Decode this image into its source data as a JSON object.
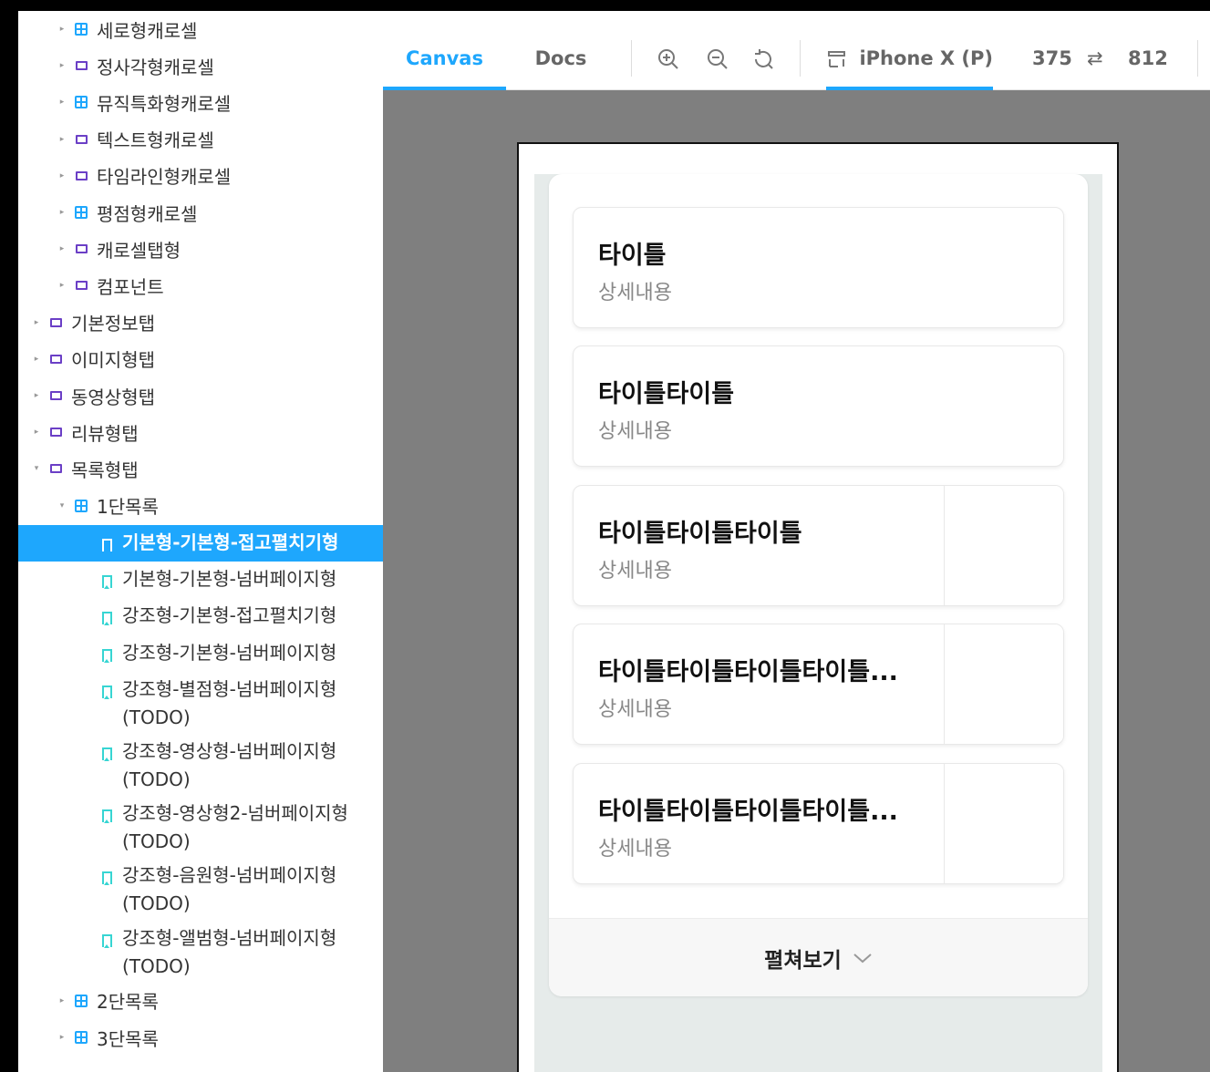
{
  "sidebar": {
    "items": [
      {
        "label": "세로형캐로셀",
        "icon": "component-icon",
        "level": 2,
        "expanded": false
      },
      {
        "label": "정사각형캐로셀",
        "icon": "folder-icon",
        "level": 2,
        "expanded": false
      },
      {
        "label": "뮤직특화형캐로셀",
        "icon": "component-icon",
        "level": 2,
        "expanded": false
      },
      {
        "label": "텍스트형캐로셀",
        "icon": "folder-icon",
        "level": 2,
        "expanded": false
      },
      {
        "label": "타임라인형캐로셀",
        "icon": "folder-icon",
        "level": 2,
        "expanded": false
      },
      {
        "label": "평점형캐로셀",
        "icon": "component-icon",
        "level": 2,
        "expanded": false
      },
      {
        "label": "캐로셀탭형",
        "icon": "folder-icon",
        "level": 2,
        "expanded": false
      },
      {
        "label": "컴포넌트",
        "icon": "folder-icon",
        "level": 2,
        "expanded": false
      },
      {
        "label": "기본정보탭",
        "icon": "folder-icon",
        "level": 1,
        "expanded": false
      },
      {
        "label": "이미지형탭",
        "icon": "folder-icon",
        "level": 1,
        "expanded": false
      },
      {
        "label": "동영상형탭",
        "icon": "folder-icon",
        "level": 1,
        "expanded": false
      },
      {
        "label": "리뷰형탭",
        "icon": "folder-icon",
        "level": 1,
        "expanded": false
      },
      {
        "label": "목록형탭",
        "icon": "folder-icon",
        "level": 1,
        "expanded": true
      },
      {
        "label": "1단목록",
        "icon": "component-icon",
        "level": 2,
        "expanded": true
      }
    ],
    "stories": [
      {
        "label": "기본형-기본형-접고펼치기형",
        "selected": true
      },
      {
        "label": "기본형-기본형-넘버페이지형",
        "selected": false
      },
      {
        "label": "강조형-기본형-접고펼치기형",
        "selected": false
      },
      {
        "label": "강조형-기본형-넘버페이지형",
        "selected": false
      },
      {
        "label": "강조형-별점형-넘버페이지형",
        "label2": "(TODO)",
        "selected": false
      },
      {
        "label": "강조형-영상형-넘버페이지형",
        "label2": "(TODO)",
        "selected": false
      },
      {
        "label": "강조형-영상형2-넘버페이지형",
        "label2": "(TODO)",
        "selected": false
      },
      {
        "label": "강조형-음원형-넘버페이지형",
        "label2": "(TODO)",
        "selected": false
      },
      {
        "label": "강조형-앨범형-넘버페이지형",
        "label2": "(TODO)",
        "selected": false
      }
    ],
    "after": [
      {
        "label": "2단목록",
        "icon": "component-icon",
        "level": 2,
        "expanded": false
      },
      {
        "label": "3단목록",
        "icon": "component-icon",
        "level": 2,
        "expanded": false
      }
    ]
  },
  "toolbar": {
    "tab_canvas": "Canvas",
    "tab_docs": "Docs",
    "viewport_label": "iPhone X (P)",
    "width": "375",
    "height": "812",
    "rotate_icon": "⇄"
  },
  "preview": {
    "cards": [
      {
        "title": "타이틀",
        "desc": "상세내용",
        "thumb": false
      },
      {
        "title": "타이틀타이틀",
        "desc": "상세내용",
        "thumb": false
      },
      {
        "title": "타이틀타이틀타이틀",
        "desc": "상세내용",
        "thumb": true
      },
      {
        "title": "타이틀타이틀타이틀타이틀...",
        "desc": "상세내용",
        "thumb": true
      },
      {
        "title": "타이틀타이틀타이틀타이틀...",
        "desc": "상세내용",
        "thumb": true
      }
    ],
    "expand_label": "펼쳐보기"
  },
  "colors": {
    "accent": "#1ea7fd",
    "folder": "#6b3fc6",
    "story": "#37d5d3",
    "canvas_bg": "#7f7f7f"
  }
}
